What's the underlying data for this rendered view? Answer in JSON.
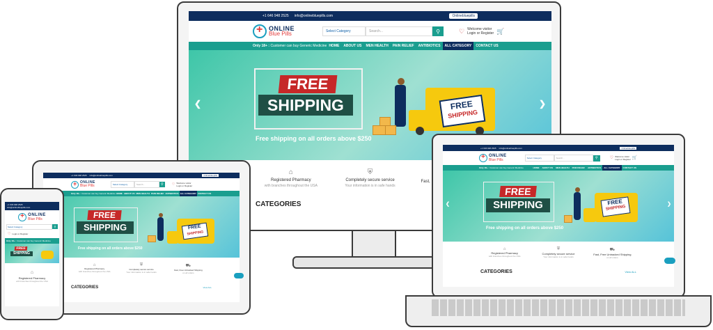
{
  "site": {
    "phone": "+1 646 948 2525",
    "email": "info@onlinebluepills.com",
    "badge": "Onlinebluepills",
    "logo_line1": "ONLINE",
    "logo_line2": "Blue Pills",
    "select_category": "Select Category",
    "search_placeholder": "Search...",
    "welcome": "Welcome visitor",
    "login": "Login or Register",
    "promo_bold": "Only 18+ :",
    "promo_text": "Customer can buy Generic Medicine",
    "menu": [
      "HOME",
      "ABOUT US",
      "MEN HEALTH",
      "PAIN RELIEF",
      "ANTIBIOTICS",
      "ALL CATEGORY",
      "CONTACT US"
    ],
    "active_menu_index": 5,
    "banner_free": "FREE",
    "banner_shipping": "SHIPPING",
    "banner_tagline": "Free shipping on all orders above $250",
    "tag_free": "FREE",
    "tag_shipping": "SHIPPING",
    "features": [
      {
        "icon": "pharmacy-icon",
        "title": "Registered Pharmacy",
        "subtitle": "with branches throughout the USA"
      },
      {
        "icon": "shield-icon",
        "title": "Completely secure service",
        "subtitle": "Your information is in safe hands"
      },
      {
        "icon": "truck-icon",
        "title": "Fast, Free Untracked Shipping",
        "subtitle": "on all orders"
      }
    ],
    "categories_heading": "CATEGORIES",
    "view_all": "View ALL"
  },
  "colors": {
    "navy": "#0d2d5e",
    "teal": "#1a9e8f",
    "red": "#c62828",
    "yellow": "#f6c90e"
  }
}
